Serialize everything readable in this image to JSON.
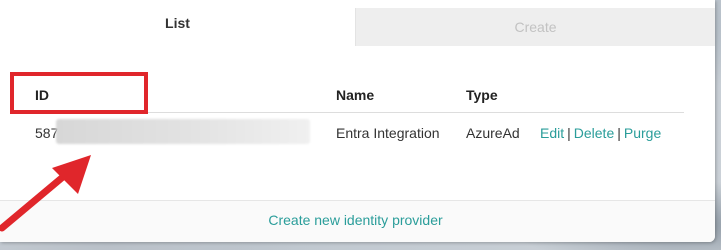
{
  "tabs": {
    "list_label": "List",
    "create_label": "Create"
  },
  "table": {
    "headers": {
      "id": "ID",
      "name": "Name",
      "type": "Type"
    },
    "rows": [
      {
        "id_visible": "587",
        "name": "Entra Integration",
        "type": "AzureAd",
        "actions": {
          "edit": "Edit",
          "delete": "Delete",
          "purge": "Purge",
          "separator": "|"
        }
      }
    ]
  },
  "footer": {
    "create_link": "Create new identity provider"
  },
  "colors": {
    "link": "#2a9d9a",
    "highlight": "#e0262b",
    "inactive_tab_bg": "#eeeeee"
  }
}
